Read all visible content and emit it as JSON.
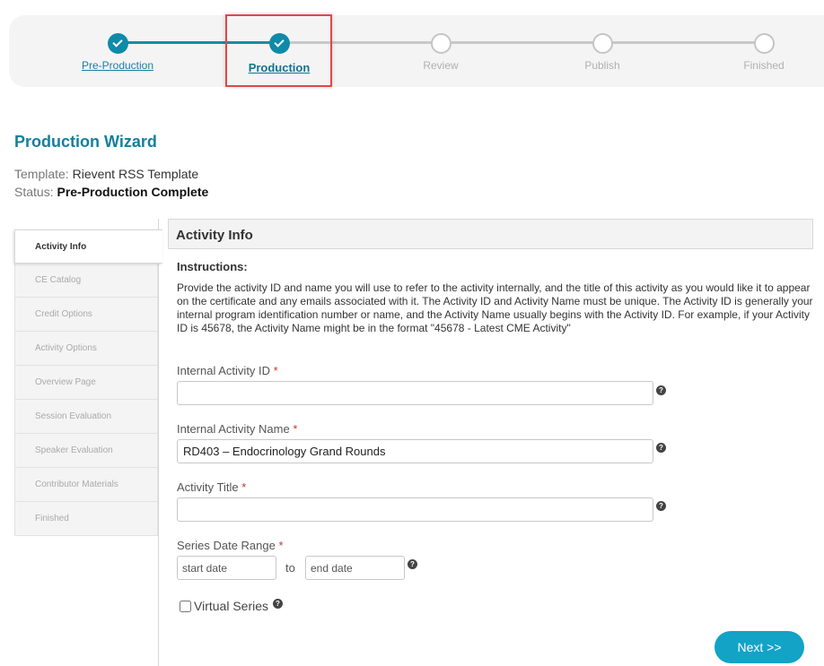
{
  "stepper": {
    "steps": [
      {
        "label": "Pre-Production",
        "state": "done"
      },
      {
        "label": "Production",
        "state": "current"
      },
      {
        "label": "Review",
        "state": "todo"
      },
      {
        "label": "Publish",
        "state": "todo"
      },
      {
        "label": "Finished",
        "state": "todo"
      }
    ]
  },
  "header": {
    "title": "Production Wizard",
    "template_key": "Template:",
    "template_value": "Rievent RSS Template",
    "status_key": "Status:",
    "status_value": "Pre-Production Complete"
  },
  "sidebar": {
    "items": [
      {
        "label": "Activity Info",
        "active": true
      },
      {
        "label": "CE Catalog"
      },
      {
        "label": "Credit Options"
      },
      {
        "label": "Activity Options"
      },
      {
        "label": "Overview Page"
      },
      {
        "label": "Session Evaluation"
      },
      {
        "label": "Speaker Evaluation"
      },
      {
        "label": "Contributor Materials"
      },
      {
        "label": "Finished"
      }
    ]
  },
  "panel": {
    "title": "Activity Info",
    "instructions_title": "Instructions:",
    "instructions_text": "Provide the activity ID and name you will use to refer to the activity internally, and the title of this activity as you would like it to appear on the certificate and any emails associated with it. The Activity ID and Activity Name must be unique. The Activity ID is generally your internal program identification number or name, and the Activity Name usually begins with the Activity ID. For example, if your Activity ID is 45678, the Activity Name might be in the format \"45678 - Latest CME Activity\""
  },
  "form": {
    "required_mark": "*",
    "activity_id": {
      "label": "Internal Activity ID",
      "value": ""
    },
    "activity_name": {
      "label": "Internal Activity Name",
      "value": "RD403 – Endocrinology Grand Rounds"
    },
    "activity_title": {
      "label": "Activity Title",
      "value": ""
    },
    "series_date_range": {
      "label": "Series Date Range",
      "start_placeholder": "start date",
      "end_placeholder": "end date",
      "to": "to"
    },
    "virtual_series": {
      "label": "Virtual Series",
      "checked": false
    },
    "help_glyph": "?",
    "next_label": "Next >>"
  },
  "colors": {
    "accent": "#0f8aa8",
    "button": "#12a3c7",
    "highlight": "#e0474c"
  }
}
